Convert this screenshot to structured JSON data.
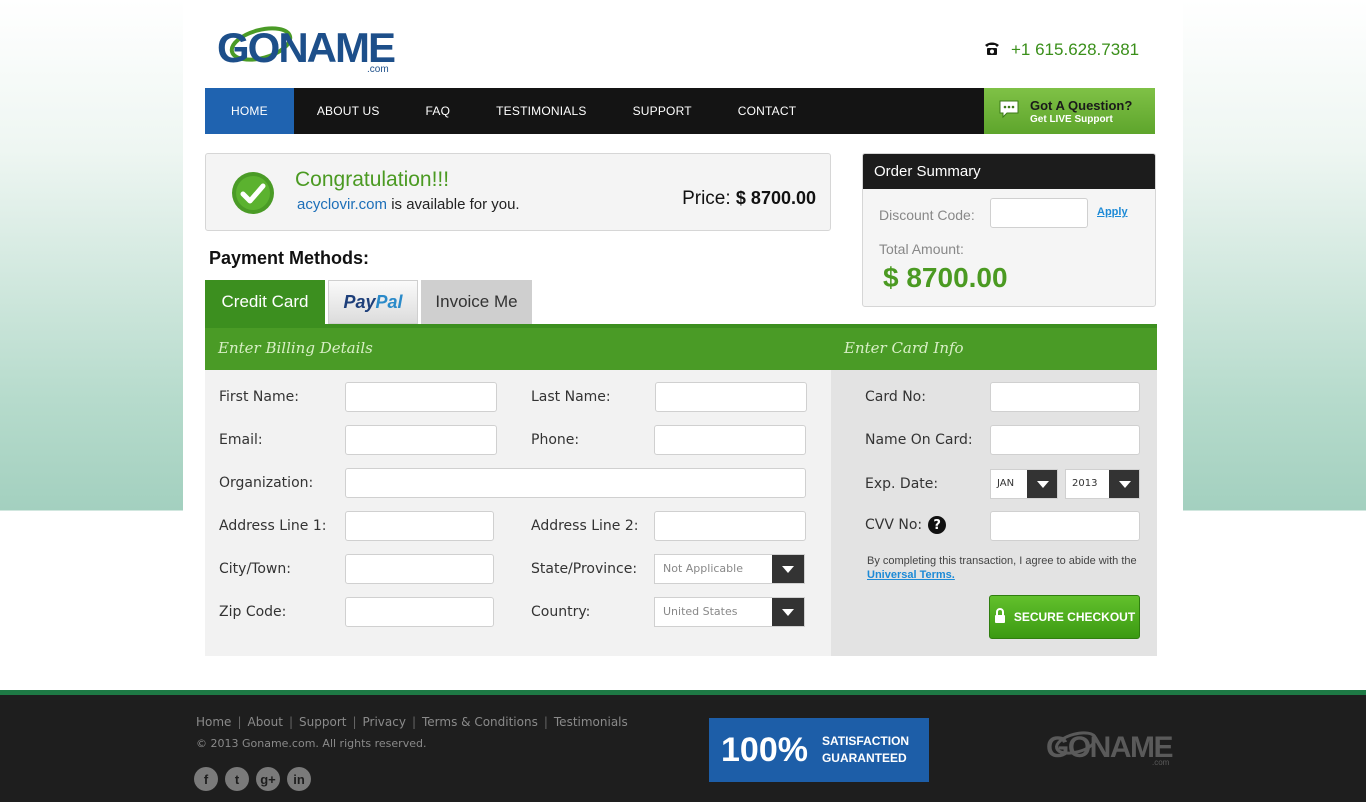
{
  "header": {
    "logo_text": "GONAME",
    "logo_suffix": ".com",
    "phone": "+1 615.628.7381"
  },
  "nav": {
    "items": [
      "HOME",
      "ABOUT US",
      "FAQ",
      "TESTIMONIALS",
      "SUPPORT",
      "CONTACT"
    ],
    "live_title": "Got A Question?",
    "live_sub": "Get LIVE Support"
  },
  "congrats": {
    "title": "Congratulation!!!",
    "domain": "acyclovir.com",
    "available_text": "is available for you.",
    "price_label": "Price:",
    "price_value": "$ 8700.00"
  },
  "payment": {
    "title": "Payment Methods:",
    "tabs": {
      "credit": "Credit Card",
      "paypal_a": "Pay",
      "paypal_b": "Pal",
      "invoice": "Invoice Me"
    },
    "billing_header": "Enter Billing Details",
    "card_header": "Enter Card Info"
  },
  "order_summary": {
    "title": "Order Summary",
    "discount_label": "Discount Code:",
    "apply": "Apply",
    "total_label": "Total Amount:",
    "total_value": "$ 8700.00"
  },
  "billing": {
    "first_name": "First Name:",
    "last_name": "Last Name:",
    "email": "Email:",
    "phone": "Phone:",
    "organization": "Organization:",
    "address1": "Address Line 1:",
    "address2": "Address Line 2:",
    "city": "City/Town:",
    "state": "State/Province:",
    "state_value": "Not Applicable",
    "zip": "Zip Code:",
    "country": "Country:",
    "country_value": "United States"
  },
  "card": {
    "card_no": "Card No:",
    "name_on_card": "Name On Card:",
    "exp_date": "Exp. Date:",
    "exp_month": "JAN",
    "exp_year": "2013",
    "cvv": "CVV No:",
    "terms_text": "By completing this transaction, I agree to abide with the",
    "terms_link": "Universal Terms.",
    "checkout": "SECURE CHECKOUT"
  },
  "footer": {
    "links": [
      "Home",
      "About",
      "Support",
      "Privacy",
      "Terms & Conditions",
      "Testimonials"
    ],
    "copyright": "© 2013 Goname.com. All rights reserved.",
    "badge_big": "100%",
    "badge_line1": "SATISFACTION",
    "badge_line2": "GUARANTEED",
    "social": [
      "f",
      "t",
      "g+",
      "in"
    ]
  },
  "colors": {
    "brand_green": "#4a9b26",
    "nav_active": "#1f63b0",
    "nav_bg": "#141414",
    "link_blue": "#1d8ad6"
  }
}
